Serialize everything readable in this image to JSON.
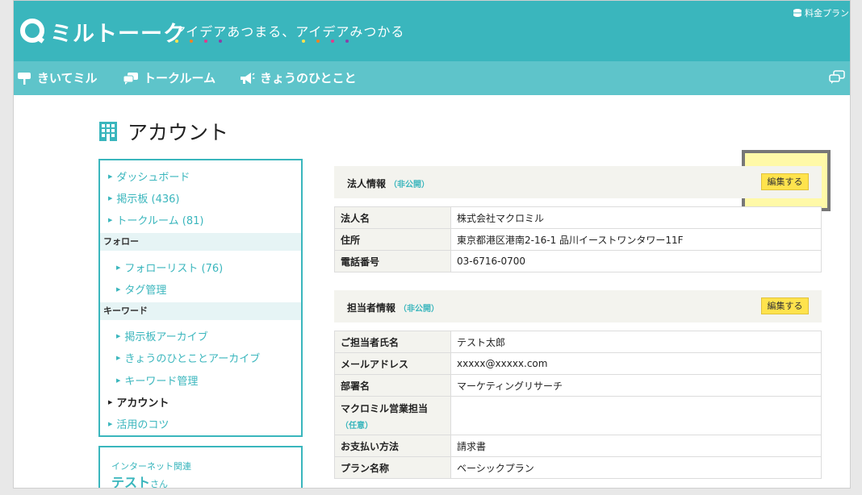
{
  "header": {
    "logo_text": "ミルトーーク",
    "tagline": "アイデアあつまる、アイデアみつかる",
    "pricing_label": "料金プラン"
  },
  "nav": {
    "items": [
      {
        "label": "きいてミル",
        "icon": "signboard-icon"
      },
      {
        "label": "トークルーム",
        "icon": "speech-bubbles-icon"
      },
      {
        "label": "きょうのひとこと",
        "icon": "megaphone-icon"
      }
    ]
  },
  "page": {
    "title": "アカウント"
  },
  "sidebar": {
    "top_links": [
      {
        "label": "ダッシュボード"
      },
      {
        "label": "掲示板 (436)"
      },
      {
        "label": "トークルーム (81)"
      }
    ],
    "follow_category": "フォロー",
    "follow_links": [
      {
        "label": "フォローリスト (76)"
      },
      {
        "label": "タグ管理"
      }
    ],
    "keyword_category": "キーワード",
    "keyword_links": [
      {
        "label": "掲示板アーカイブ"
      },
      {
        "label": "きょうのひとことアーカイブ"
      },
      {
        "label": "キーワード管理"
      }
    ],
    "bottom_links": [
      {
        "label": "アカウント",
        "active": true
      },
      {
        "label": "活用のコツ"
      }
    ]
  },
  "user": {
    "category": "インターネット関連",
    "name": "テスト",
    "honorific": "さん"
  },
  "corporate": {
    "title": "法人情報",
    "visibility": "（非公開）",
    "edit_label": "編集する",
    "rows": [
      {
        "key": "法人名",
        "value": "株式会社マクロミル"
      },
      {
        "key": "住所",
        "value": "東京都港区港南2-16-1 品川イーストワンタワー11F"
      },
      {
        "key": "電話番号",
        "value": "03-6716-0700"
      }
    ]
  },
  "contact": {
    "title": "担当者情報",
    "visibility": "（非公開）",
    "edit_label": "編集する",
    "rows": [
      {
        "key": "ご担当者氏名",
        "value": "テスト太郎"
      },
      {
        "key": "メールアドレス",
        "value": "xxxxx@xxxxx.com"
      },
      {
        "key": "部署名",
        "value": "マーケティングリサーチ"
      },
      {
        "key": "マクロミル営業担当",
        "sub": "（任意）",
        "value": ""
      },
      {
        "key": "お支払い方法",
        "value": "請求書"
      },
      {
        "key": "プラン名称",
        "value": "ベーシックプラン"
      }
    ]
  },
  "colors": {
    "brand": "#3ab6bd",
    "nav": "#5ec4ca",
    "button": "#ffe34d",
    "highlight": "#fff9a8"
  }
}
